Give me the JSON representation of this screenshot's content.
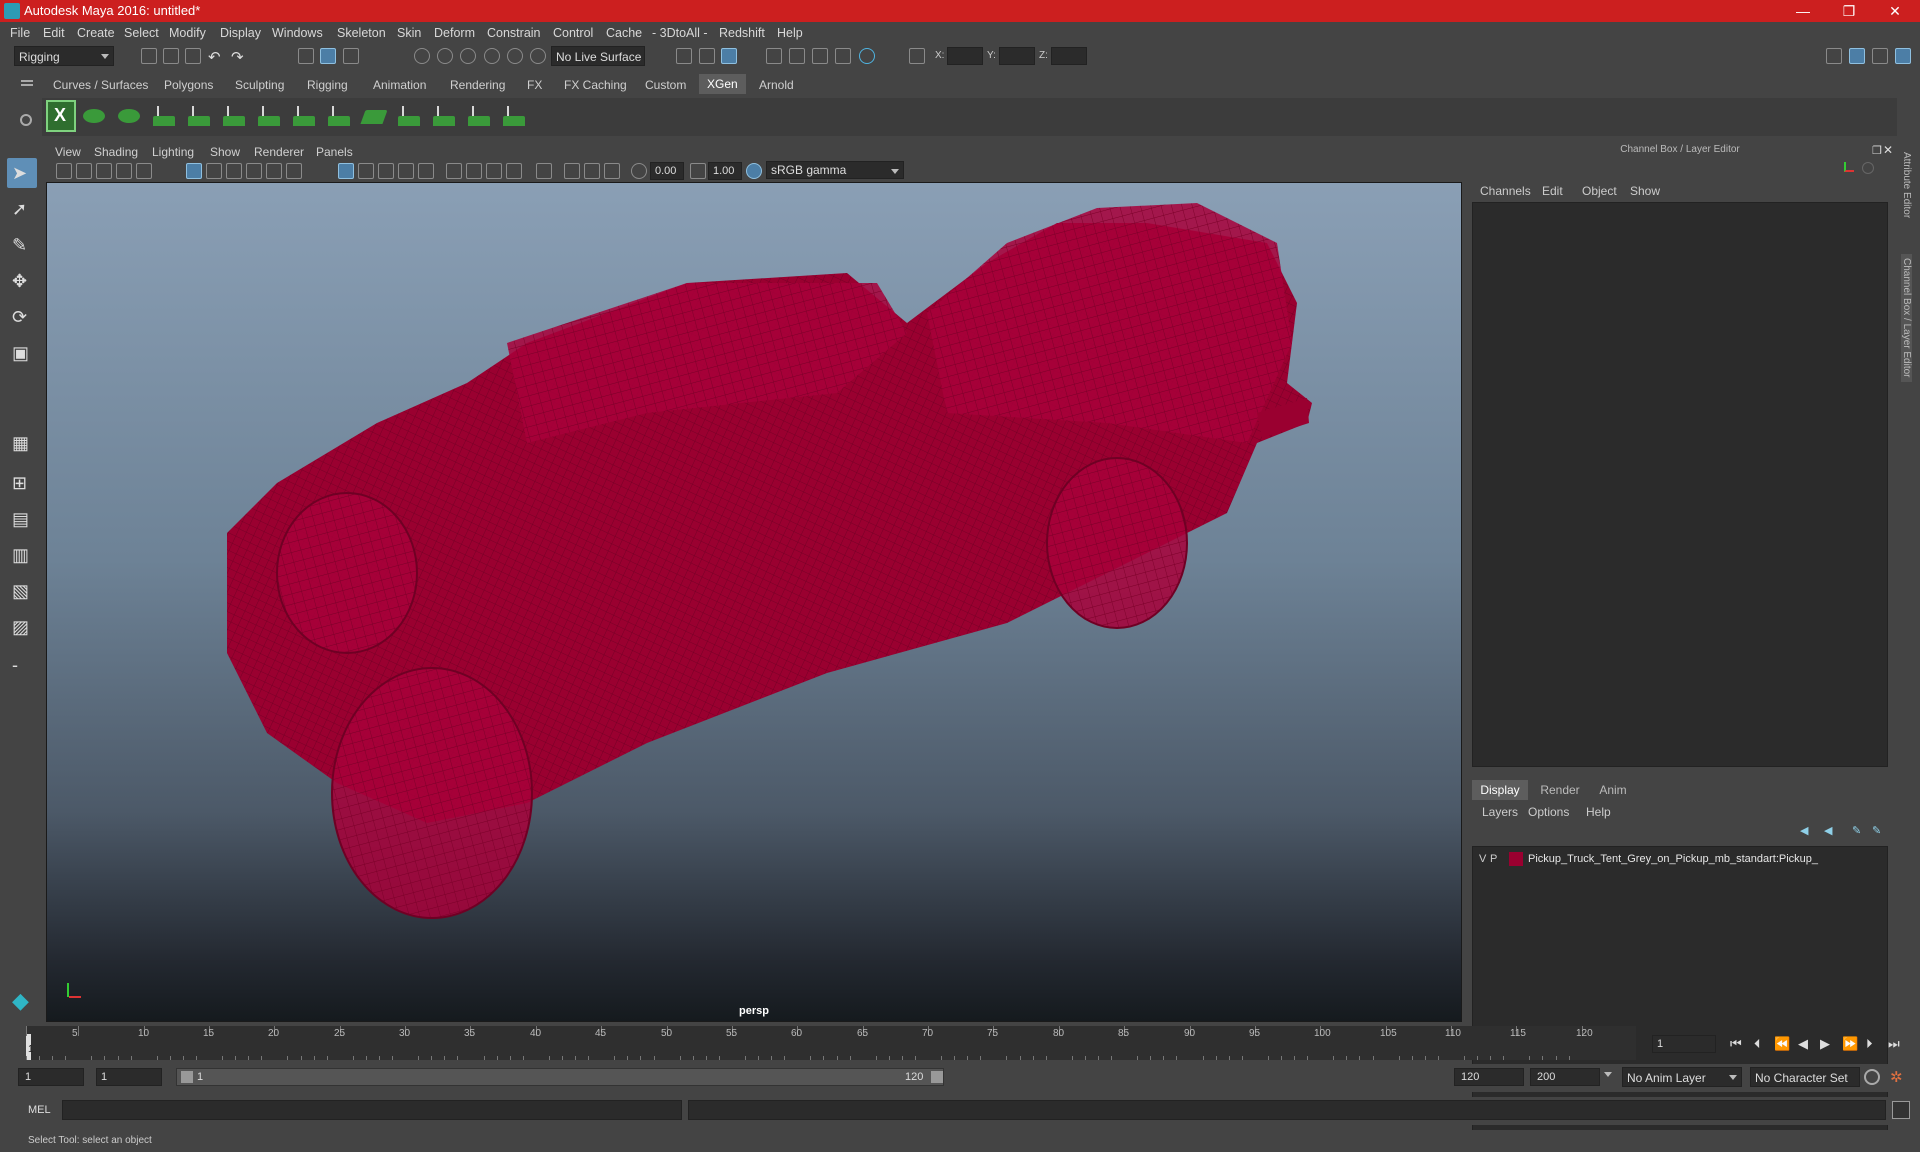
{
  "window": {
    "title": "Autodesk Maya 2016: untitled*",
    "min": "—",
    "max": "❐",
    "close": "✕"
  },
  "menubar": [
    "File",
    "Edit",
    "Create",
    "Select",
    "Modify",
    "Display",
    "Windows",
    "Skeleton",
    "Skin",
    "Deform",
    "Constrain",
    "Control",
    "Cache",
    "- 3DtoAll -",
    "Redshift",
    "Help"
  ],
  "statusline": {
    "menuset": "Rigging",
    "live_surface": "No Live Surface",
    "x_label": "X:",
    "y_label": "Y:",
    "z_label": "Z:"
  },
  "shelf_tabs": [
    "Curves / Surfaces",
    "Polygons",
    "Sculpting",
    "Rigging",
    "Animation",
    "Rendering",
    "FX",
    "FX Caching",
    "Custom",
    "XGen",
    "Arnold"
  ],
  "shelf_active_tab": "XGen",
  "shelf_icons": [
    "xgen-icon",
    "xgen-visibility-icon",
    "xgen-toggle-icon",
    "xgen-description-icon",
    "xgen-guide-add-icon",
    "xgen-guide-place-icon",
    "xgen-guide-select-icon",
    "xgen-guide-lock-icon",
    "xgen-guide-sculpt-icon",
    "xgen-layers-icon",
    "xgen-brush-icon",
    "xgen-comb-icon",
    "xgen-groom-icon",
    "xgen-cut-icon"
  ],
  "viewport": {
    "menu": [
      "View",
      "Shading",
      "Lighting",
      "Show",
      "Renderer",
      "Panels"
    ],
    "exposure": "0.00",
    "gamma": "1.00",
    "color_space": "sRGB gamma",
    "camera": "persp",
    "mesh_color": "#9a0030",
    "bg_top": "#8a9fb5",
    "bg_bottom": "#151a1e"
  },
  "channel_box": {
    "title": "Channel Box / Layer Editor",
    "menu": [
      "Channels",
      "Edit",
      "Object",
      "Show"
    ]
  },
  "layer_editor": {
    "tabs": [
      "Display",
      "Render",
      "Anim"
    ],
    "active_tab": "Display",
    "menu": [
      "Layers",
      "Options",
      "Help"
    ],
    "layers": [
      {
        "v": "V",
        "p": "P",
        "color": "#9a0030",
        "name": "Pickup_Truck_Tent_Grey_on_Pickup_mb_standart:Pickup_"
      }
    ]
  },
  "side_tabs": [
    "Attribute Editor",
    "Channel Box / Layer Editor"
  ],
  "timeline": {
    "ticks": [
      1,
      5,
      10,
      15,
      20,
      25,
      30,
      35,
      40,
      45,
      50,
      55,
      60,
      65,
      70,
      75,
      80,
      85,
      90,
      95,
      100,
      105,
      110,
      115,
      120
    ],
    "current_frame": "1",
    "current_frame_marker": "1"
  },
  "range": {
    "start": "1",
    "playback_start": "1",
    "slider_start": "1",
    "slider_end": "120",
    "playback_end": "120",
    "end": "200",
    "anim_layer": "No Anim Layer",
    "character_set": "No Character Set"
  },
  "command": {
    "language": "MEL"
  },
  "help_line": "Select Tool: select an object"
}
